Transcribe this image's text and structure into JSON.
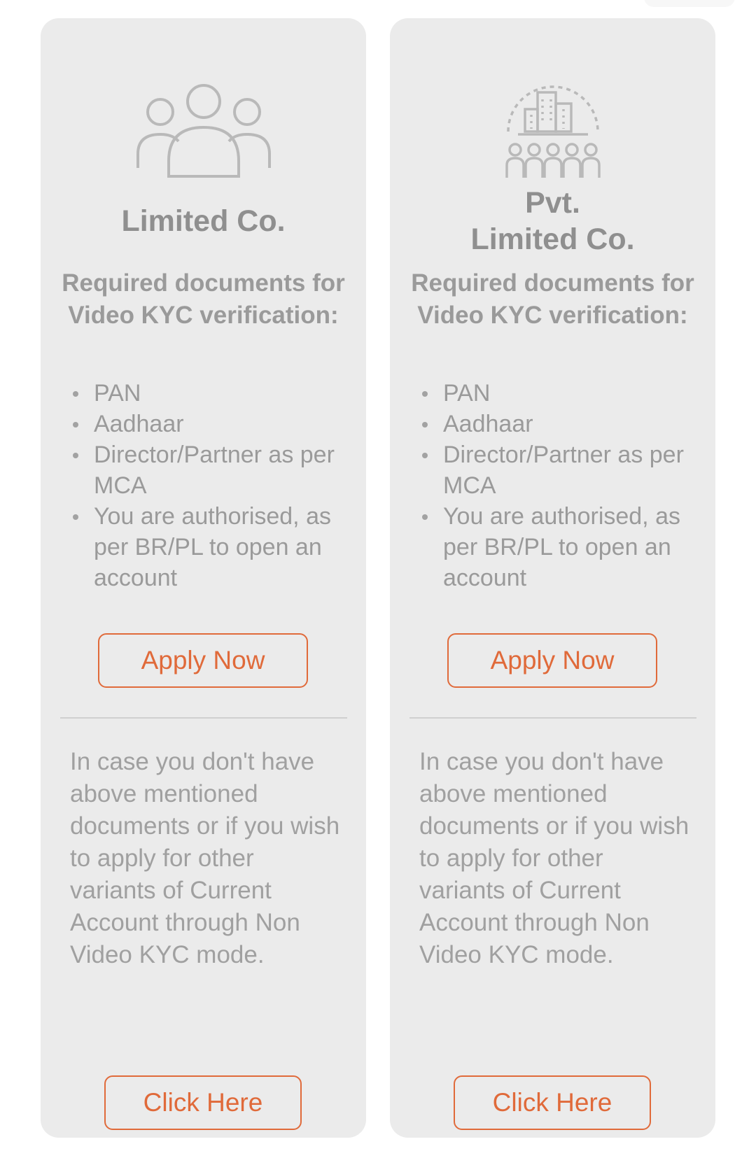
{
  "cards": [
    {
      "icon": "people-group-icon",
      "title": "Limited Co.",
      "required_heading": "Required documents for Video KYC verification:",
      "documents": [
        "PAN",
        "Aadhaar",
        "Director/Partner as per MCA",
        "You are authorised, as per BR/PL to open an account"
      ],
      "apply_label": "Apply Now",
      "alt_text": "In case you don't have above mentioned documents or if you wish to apply for other variants of Current Account through Non Video KYC mode.",
      "click_label": "Click Here"
    },
    {
      "icon": "company-building-icon",
      "title": "Pvt.\nLimited Co.",
      "required_heading": "Required documents for Video KYC verification:",
      "documents": [
        "PAN",
        "Aadhaar",
        "Director/Partner as per MCA",
        "You are authorised, as per BR/PL to open an account"
      ],
      "apply_label": "Apply Now",
      "alt_text": "In case you don't have above mentioned documents or if you wish to apply for other variants of Current Account through Non Video KYC mode.",
      "click_label": "Click Here"
    }
  ],
  "colors": {
    "card_bg": "#ebebeb",
    "accent": "#e06a3a",
    "text_gray": "#9a9a9a"
  }
}
